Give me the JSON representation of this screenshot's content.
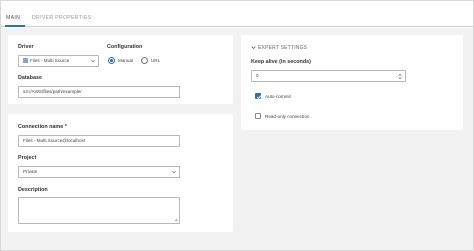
{
  "tabs": [
    {
      "label": "MAIN",
      "active": true
    },
    {
      "label": "DRIVER PROPERTIES",
      "active": false
    }
  ],
  "driver": {
    "label": "Driver",
    "selected": "Files - Multi Source"
  },
  "configuration": {
    "label": "Configuration",
    "options": [
      "Manual",
      "URL"
    ],
    "selected": "Manual"
  },
  "database": {
    "label": "Database",
    "value": "s3://AWS/files/path/example/"
  },
  "connection_name": {
    "label": "Connection name *",
    "value": "Files - Multi Source@localhost"
  },
  "project": {
    "label": "Project",
    "selected": "Private"
  },
  "description": {
    "label": "Description",
    "value": ""
  },
  "expert_settings": {
    "label": "EXPERT SETTINGS",
    "keep_alive_label": "Keep alive (in seconds)",
    "keep_alive_value": "0",
    "auto_commit_label": "Auto-commit",
    "auto_commit_checked": true,
    "read_only_label": "Read-only connection",
    "read_only_checked": false
  },
  "colors": {
    "accent": "#2d6fb3",
    "background": "#f2f2f2",
    "panel": "#ffffff"
  }
}
